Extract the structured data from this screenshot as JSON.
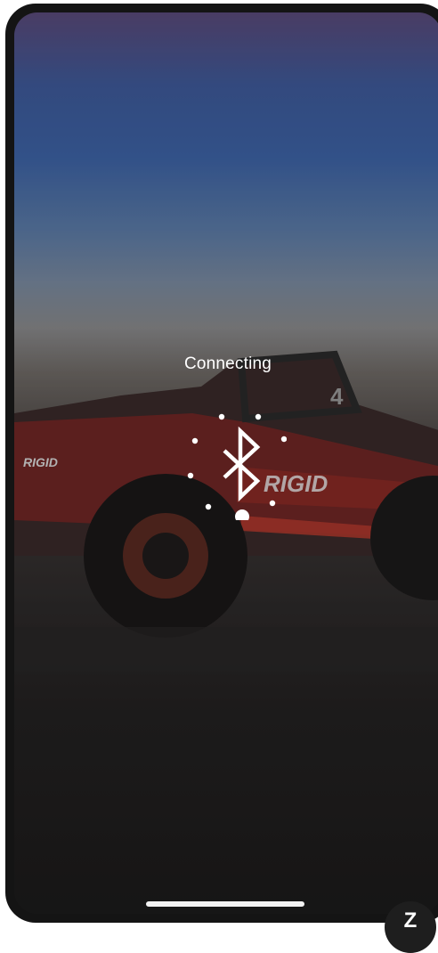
{
  "status": {
    "connecting_label": "Connecting"
  },
  "spinner": {
    "icon": "bluetooth-icon"
  },
  "badge": {
    "label": "Z"
  },
  "colors": {
    "text": "#ffffff",
    "frame": "#141414"
  }
}
